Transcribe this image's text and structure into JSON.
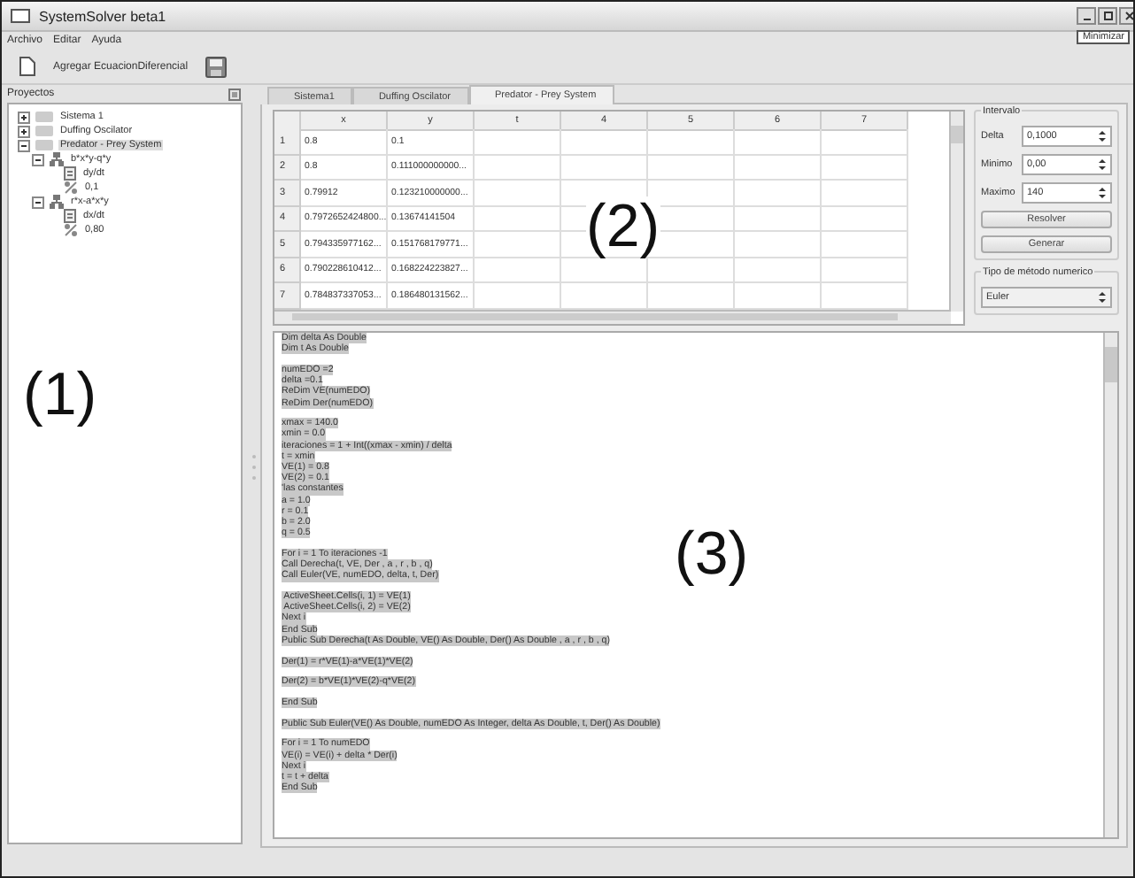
{
  "window": {
    "title": "SystemSolver beta1",
    "tooltip": "Minimizar"
  },
  "menu": [
    "Archivo",
    "Editar",
    "Ayuda"
  ],
  "toolbar": {
    "button": "Agregar EcuacionDiferencial"
  },
  "projects": {
    "title": "Proyectos",
    "tree": [
      {
        "label": "Sistema 1",
        "kind": "system",
        "expanded": false,
        "selected": false
      },
      {
        "label": "Duffing Oscilator",
        "kind": "system",
        "expanded": false,
        "selected": false
      },
      {
        "label": "Predator - Prey System",
        "kind": "system",
        "expanded": true,
        "selected": true,
        "children": [
          {
            "label": "b*x*y-q*y",
            "kind": "equation",
            "expanded": true,
            "selected": false,
            "children": [
              {
                "label": "dy/dt",
                "kind": "derivative",
                "selected": false
              },
              {
                "label": "0,1",
                "kind": "initial",
                "selected": false
              }
            ]
          },
          {
            "label": "r*x-a*x*y",
            "kind": "equation",
            "expanded": true,
            "selected": false,
            "children": [
              {
                "label": "dx/dt",
                "kind": "derivative",
                "selected": false
              },
              {
                "label": "0,80",
                "kind": "initial",
                "selected": false
              }
            ]
          }
        ]
      }
    ]
  },
  "tabs": [
    {
      "label": "Sistema1",
      "selected": false
    },
    {
      "label": "Duffing Oscilator",
      "selected": false
    },
    {
      "label": "Predator - Prey System",
      "selected": true
    }
  ],
  "table": {
    "columns": [
      "x",
      "y",
      "t",
      "4",
      "5",
      "6",
      "7"
    ],
    "rows": [
      {
        "index": "1",
        "cells": [
          "0.8",
          "0.1"
        ]
      },
      {
        "index": "2",
        "cells": [
          "0.8",
          "0.111000000000..."
        ]
      },
      {
        "index": "3",
        "cells": [
          "0.79912",
          "0.123210000000..."
        ]
      },
      {
        "index": "4",
        "cells": [
          "0.7972652424800...",
          "0.13674141504"
        ]
      },
      {
        "index": "5",
        "cells": [
          "0.794335977162...",
          "0.151768179771..."
        ]
      },
      {
        "index": "6",
        "cells": [
          "0.790228610412...",
          "0.168224223827..."
        ]
      },
      {
        "index": "7",
        "cells": [
          "0.784837337053...",
          "0.186480131562..."
        ]
      }
    ]
  },
  "interval": {
    "title": "Intervalo",
    "fields": [
      {
        "label": "Delta",
        "value": "0,1000"
      },
      {
        "label": "Minimo",
        "value": "0,00"
      },
      {
        "label": "Maximo",
        "value": "140"
      }
    ],
    "buttons": [
      "Resolver",
      "Generar"
    ]
  },
  "method": {
    "title": "Tipo de método numerico",
    "value": "Euler"
  },
  "code": {
    "blocks": [
      [
        "Dim delta As Double",
        "Dim t As Double"
      ],
      [
        "numEDO =2",
        "delta =0.1",
        "ReDim VE(numEDO)",
        "ReDim Der(numEDO)"
      ],
      [
        "xmax = 140.0",
        "xmin = 0.0",
        "iteraciones = 1 + Int((xmax - xmin) / delta",
        "t = xmin",
        "VE(1) = 0.8",
        "VE(2) = 0.1",
        "'las constantes",
        "a = 1.0",
        "r = 0.1",
        "b = 2.0",
        "q = 0.5"
      ],
      [
        "For i = 1 To iteraciones -1",
        "Call Derecha(t, VE, Der , a , r , b , q)",
        "Call Euler(VE, numEDO, delta, t, Der)"
      ],
      [
        " ActiveSheet.Cells(i, 1) = VE(1)",
        " ActiveSheet.Cells(i, 2) = VE(2)",
        "Next i",
        "End Sub",
        "Public Sub Derecha(t As Double, VE() As Double, Der() As Double , a , r , b , q)"
      ],
      [
        "Der(1) = r*VE(1)-a*VE(1)*VE(2)"
      ],
      [
        "Der(2) = b*VE(1)*VE(2)-q*VE(2)"
      ],
      [
        "End Sub"
      ],
      [
        "Public Sub Euler(VE() As Double, numEDO As Integer, delta As Double, t, Der() As Double)"
      ],
      [
        "For i = 1 To numEDO",
        "VE(i) = VE(i) + delta * Der(i)",
        "Next i",
        "t = t + delta",
        "End Sub"
      ]
    ]
  },
  "annotations": [
    "(1)",
    "(2)",
    "(3)"
  ]
}
